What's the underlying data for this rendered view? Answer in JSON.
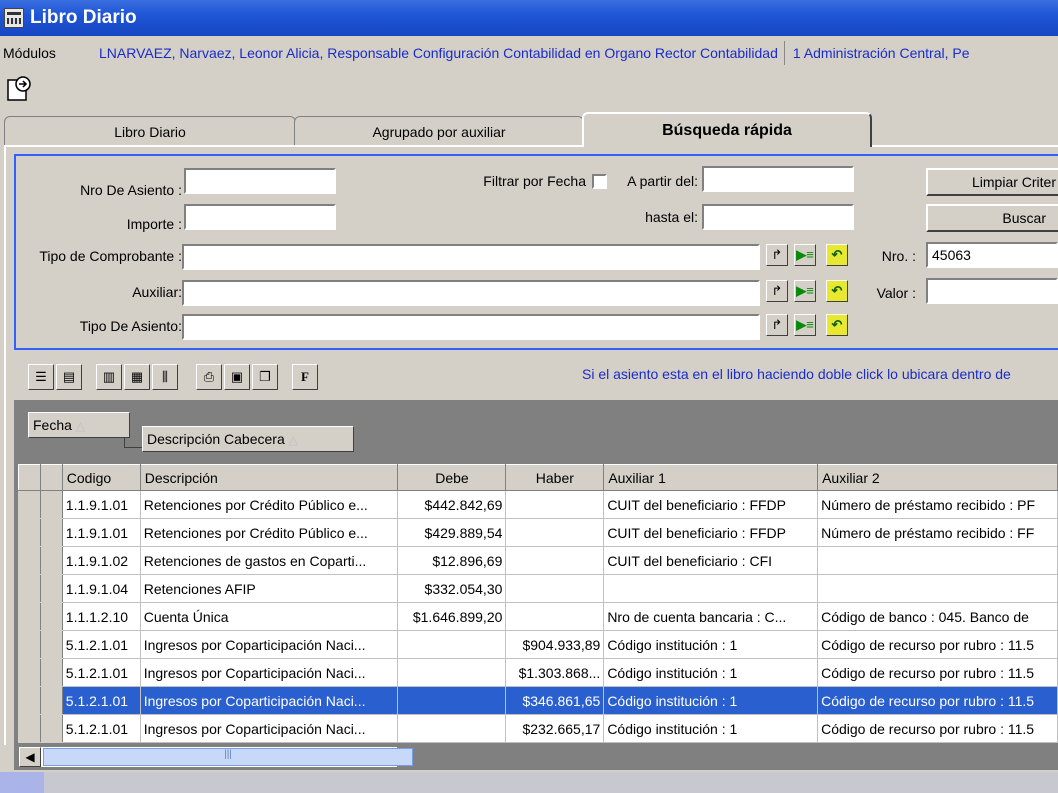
{
  "window": {
    "title": "Libro Diario"
  },
  "modules": {
    "label": "Módulos",
    "user": "LNARVAEZ, Narvaez, Leonor Alicia, Responsable Configuración Contabilidad en Organo Rector Contabilidad",
    "org": "1 Administración Central, Pe"
  },
  "tabs": [
    {
      "label": "Libro Diario"
    },
    {
      "label": "Agrupado por auxiliar"
    },
    {
      "label": "Búsqueda rápida"
    }
  ],
  "filters": {
    "nro_asiento": {
      "label": "Nro De Asiento :",
      "value": ""
    },
    "importe": {
      "label": "Importe :",
      "value": ""
    },
    "tipo_comprobante": {
      "label": "Tipo de Comprobante :",
      "value": ""
    },
    "auxiliar": {
      "label": "Auxiliar:",
      "value": ""
    },
    "tipo_asiento": {
      "label": "Tipo De Asiento:",
      "value": ""
    },
    "filtrar_fecha": {
      "label": "Filtrar por Fecha"
    },
    "a_partir": {
      "label": "A partir del:",
      "value": ""
    },
    "hasta": {
      "label": "hasta el:",
      "value": ""
    },
    "nro": {
      "label": "Nro. :",
      "value": "45063"
    },
    "valor": {
      "label": "Valor :",
      "value": ""
    },
    "limpiar_label": "Limpiar Criter",
    "buscar_label": "Buscar"
  },
  "hint": "Si el asiento esta en el libro haciendo doble click lo ubicara dentro de",
  "grouping": {
    "g1": "Fecha",
    "g2": "Descripción Cabecera"
  },
  "columns": [
    "Codigo",
    "Descripción",
    "Debe",
    "Haber",
    "Auxiliar 1",
    "Auxiliar 2"
  ],
  "rows": [
    [
      "1.1.9.1.01",
      "Retenciones por Crédito Público e...",
      "$442.842,69",
      "",
      "CUIT del beneficiario : FFDP",
      "Número de préstamo recibido : PF"
    ],
    [
      "1.1.9.1.01",
      "Retenciones por Crédito Público e...",
      "$429.889,54",
      "",
      "CUIT del beneficiario : FFDP",
      "Número de préstamo recibido : FF"
    ],
    [
      "1.1.9.1.02",
      "Retenciones de gastos en Coparti...",
      "$12.896,69",
      "",
      "CUIT del beneficiario : CFI",
      ""
    ],
    [
      "1.1.9.1.04",
      "Retenciones AFIP",
      "$332.054,30",
      "",
      "",
      ""
    ],
    [
      "1.1.1.2.10",
      "Cuenta Única",
      "$1.646.899,20",
      "",
      "Nro de cuenta bancaria : C...",
      "Código de banco : 045. Banco de"
    ],
    [
      "5.1.2.1.01",
      "Ingresos por Coparticipación Naci...",
      "",
      "$904.933,89",
      "Código institución  : 1",
      "Código de recurso por rubro : 11.5"
    ],
    [
      "5.1.2.1.01",
      "Ingresos por Coparticipación Naci...",
      "",
      "$1.303.868...",
      "Código institución  : 1",
      "Código de recurso por rubro : 11.5"
    ],
    [
      "5.1.2.1.01",
      "Ingresos por Coparticipación Naci...",
      "",
      "$346.861,65",
      "Código institución  : 1",
      "Código de recurso por rubro : 11.5"
    ],
    [
      "5.1.2.1.01",
      "Ingresos por Coparticipación Naci...",
      "",
      "$232.665,17",
      "Código institución  : 1",
      "Código de recurso por rubro : 11.5"
    ]
  ],
  "selected_row": 7
}
